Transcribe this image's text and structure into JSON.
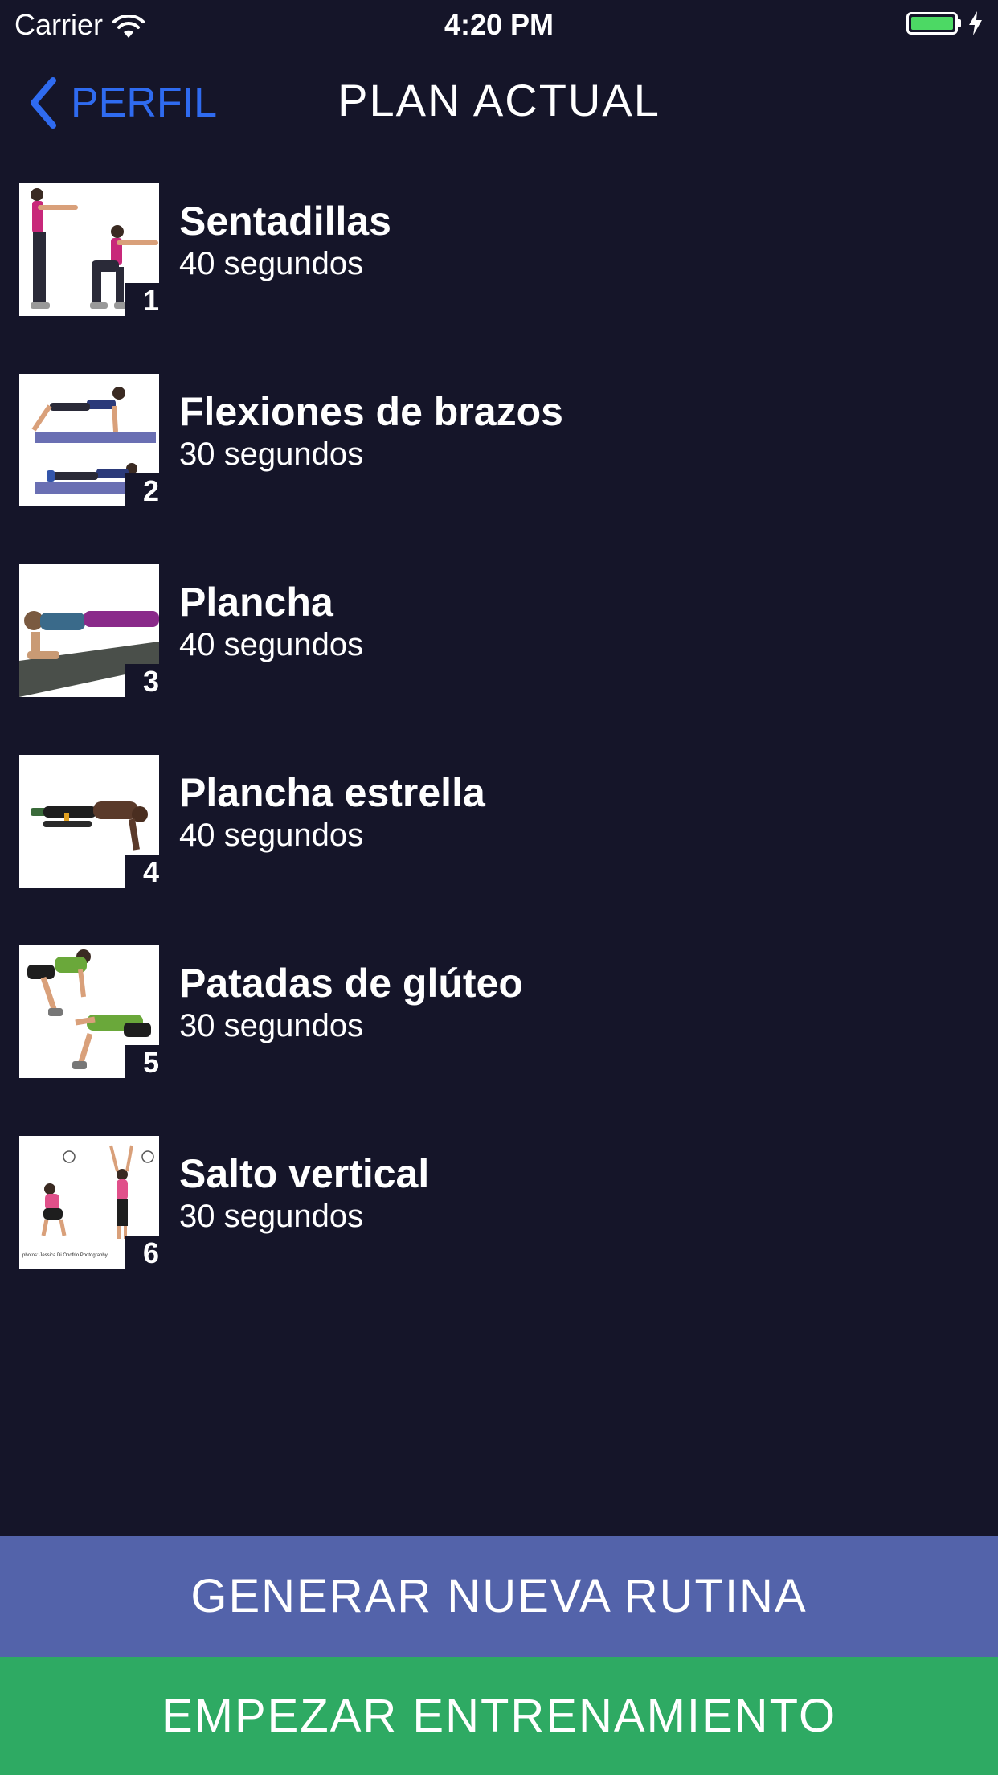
{
  "status_bar": {
    "carrier": "Carrier",
    "time": "4:20 PM",
    "battery_color": "#4cd964"
  },
  "nav": {
    "back_label": "PERFIL",
    "title": "PLAN ACTUAL",
    "accent_color": "#2f6bf0"
  },
  "exercises": [
    {
      "number": "1",
      "name": "Sentadillas",
      "duration": "40 segundos"
    },
    {
      "number": "2",
      "name": "Flexiones de brazos",
      "duration": "30 segundos"
    },
    {
      "number": "3",
      "name": "Plancha",
      "duration": "40 segundos"
    },
    {
      "number": "4",
      "name": "Plancha estrella",
      "duration": "40 segundos"
    },
    {
      "number": "5",
      "name": "Patadas de glúteo",
      "duration": "30 segundos"
    },
    {
      "number": "6",
      "name": "Salto vertical",
      "duration": "30 segundos"
    }
  ],
  "thumb_6_caption": "photos: Jessica Di Onofrio Photography",
  "buttons": {
    "generate": "GENERAR NUEVA RUTINA",
    "start": "EMPEZAR ENTRENAMIENTO"
  },
  "colors": {
    "background": "#151529",
    "generate_button": "#5363aa",
    "start_button": "#2eaa63"
  }
}
